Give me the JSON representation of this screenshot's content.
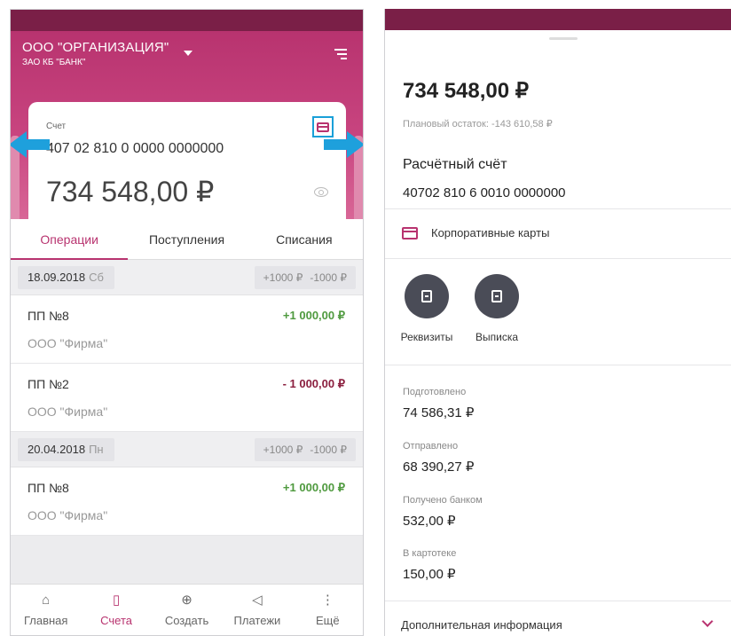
{
  "left": {
    "header": {
      "org_name": "ООО \"ОРГАНИЗАЦИЯ\"",
      "bank_name": "ЗАО КБ \"БАНК\""
    },
    "account_card": {
      "label": "Счет",
      "number": "407 02 810 0 0000 0000000",
      "balance": "734 548,00 ₽"
    },
    "tabs": [
      {
        "label": "Операции",
        "active": true
      },
      {
        "label": "Поступления",
        "active": false
      },
      {
        "label": "Списания",
        "active": false
      }
    ],
    "groups": [
      {
        "date": "18.09.2018",
        "weekday": "Сб",
        "income": "+1000 ₽",
        "expense": "-1000 ₽",
        "items": [
          {
            "title": "ПП №8",
            "counterparty": "ООО \"Фирма\"",
            "amount": "+1 000,00 ₽",
            "direction": "in"
          },
          {
            "title": "ПП №2",
            "counterparty": "ООО \"Фирма\"",
            "amount": "- 1 000,00 ₽",
            "direction": "out"
          }
        ]
      },
      {
        "date": "20.04.2018",
        "weekday": "Пн",
        "income": "+1000 ₽",
        "expense": "-1000 ₽",
        "items": [
          {
            "title": "ПП №8",
            "counterparty": "ООО \"Фирма\"",
            "amount": "+1 000,00 ₽",
            "direction": "in"
          }
        ]
      }
    ],
    "nav": [
      {
        "label": "Главная",
        "icon": "home-icon",
        "active": false
      },
      {
        "label": "Счета",
        "icon": "document-icon",
        "active": true
      },
      {
        "label": "Создать",
        "icon": "plus-circle-icon",
        "active": false
      },
      {
        "label": "Платежи",
        "icon": "send-icon",
        "active": false
      },
      {
        "label": "Ещё",
        "icon": "more-vertical-icon",
        "active": false
      }
    ]
  },
  "right": {
    "balance": "734 548,00 ₽",
    "planned_balance": "Плановый остаток: -143 610,58 ₽",
    "account_type": "Расчётный счёт",
    "account_number": "40702 810 6 0010 0000000",
    "corporate_cards": "Корпоративные карты",
    "actions": [
      {
        "label": "Реквизиты",
        "icon": "document-icon"
      },
      {
        "label": "Выписка",
        "icon": "export-document-icon"
      }
    ],
    "stats": [
      {
        "label": "Подготовлено",
        "value": "74  586,31 ₽"
      },
      {
        "label": "Отправлено",
        "value": "68  390,27 ₽"
      },
      {
        "label": "Получено банком",
        "value": "532,00 ₽"
      },
      {
        "label": "В картотеке",
        "value": "150,00 ₽"
      }
    ],
    "more_info": "Дополнительная информация"
  },
  "colors": {
    "brand": "#b8336f",
    "brand_dark": "#7a1f47",
    "income": "#4f9a3f",
    "expense": "#8b1f3f",
    "annotation_arrow": "#1ea0dc"
  }
}
